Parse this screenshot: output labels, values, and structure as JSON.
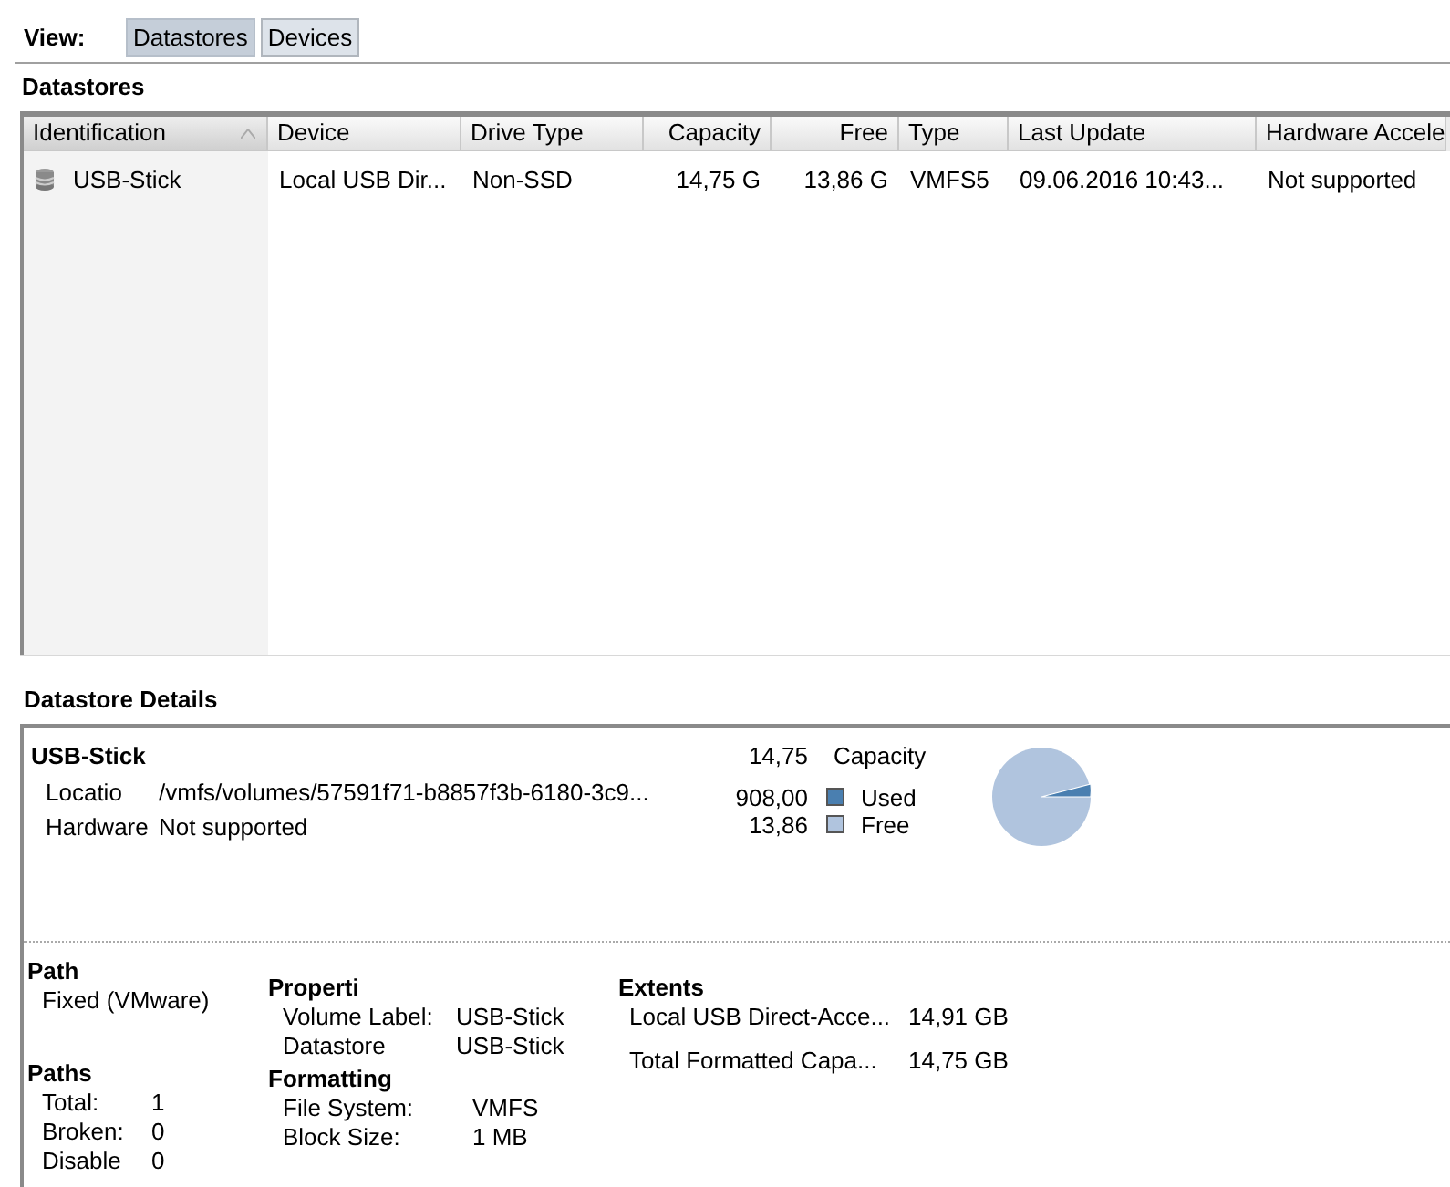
{
  "view": {
    "label": "View:",
    "tabs": [
      {
        "label": "Datastores",
        "selected": true
      },
      {
        "label": "Devices",
        "selected": false
      }
    ]
  },
  "datastores": {
    "title": "Datastores",
    "columns": [
      {
        "label": "Identification",
        "kind": "text",
        "sorted": true
      },
      {
        "label": "Device",
        "kind": "text",
        "sorted": false
      },
      {
        "label": "Drive Type",
        "kind": "text",
        "sorted": false
      },
      {
        "label": "Capacity",
        "kind": "number",
        "sorted": false
      },
      {
        "label": "Free",
        "kind": "number",
        "sorted": false
      },
      {
        "label": "Type",
        "kind": "text",
        "sorted": false
      },
      {
        "label": "Last Update",
        "kind": "text",
        "sorted": false
      },
      {
        "label": "Hardware Accele",
        "kind": "text",
        "sorted": false
      }
    ],
    "rows": [
      {
        "cells": [
          "USB-Stick",
          "Local USB Dir...",
          "Non-SSD",
          "14,75 G",
          "13,86 G",
          "VMFS5",
          "09.06.2016 10:43...",
          "Not supported"
        ]
      }
    ]
  },
  "details": {
    "title": "Datastore Details",
    "name": "USB-Stick",
    "info": [
      {
        "label": "Locatio",
        "value": "/vmfs/volumes/57591f71-b8857f3b-6180-3c9..."
      },
      {
        "label": "Hardware",
        "value": "Not supported"
      }
    ],
    "capacity": {
      "value": "14,75",
      "label": "Capacity"
    },
    "legend": [
      {
        "value": "908,00",
        "label": "Used",
        "color": "#4a7fb0"
      },
      {
        "value": "13,86",
        "label": "Free",
        "color": "#b0c4de"
      }
    ],
    "path": {
      "title": "Path",
      "value": "Fixed (VMware)"
    },
    "paths": {
      "title": "Paths",
      "rows": [
        {
          "label": "Total:",
          "value": "1"
        },
        {
          "label": "Broken:",
          "value": "0"
        },
        {
          "label": "Disable",
          "value": "0"
        }
      ]
    },
    "properties": {
      "title": "Properti",
      "rows": [
        {
          "label": "Volume Label:",
          "value": "USB-Stick"
        },
        {
          "label": "Datastore",
          "value": "USB-Stick"
        }
      ]
    },
    "formatting": {
      "title": "Formatting",
      "rows": [
        {
          "label": "File System:",
          "value": "VMFS"
        },
        {
          "label": "Block Size:",
          "value": "1 MB"
        }
      ]
    },
    "extents": {
      "title": "Extents",
      "rows": [
        {
          "label": "Local USB Direct-Acce...",
          "value": "14,91 GB"
        },
        {
          "label": "Total Formatted Capa...",
          "value": "14,75 GB"
        }
      ]
    }
  }
}
